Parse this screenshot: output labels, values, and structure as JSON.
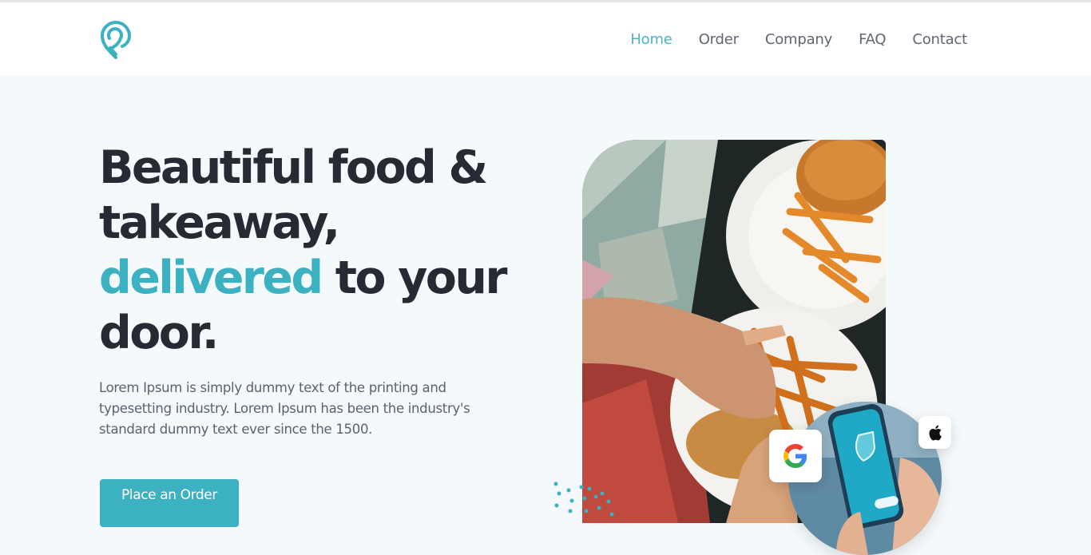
{
  "nav": {
    "items": [
      {
        "label": "Home",
        "active": true
      },
      {
        "label": "Order",
        "active": false
      },
      {
        "label": "Company",
        "active": false
      },
      {
        "label": "FAQ",
        "active": false
      },
      {
        "label": "Contact",
        "active": false
      }
    ]
  },
  "hero": {
    "title_line1": "Beautiful food &",
    "title_line2": "takeaway,",
    "title_accent": "delivered",
    "title_line3_rest": " to your",
    "title_line4": "door.",
    "description": "Lorem Ipsum is simply dummy text of the printing and typesetting industry. Lorem Ipsum has been the industry's standard dummy text ever since the 1500.",
    "cta_label": "Place an Order"
  },
  "icons": {
    "logo": "location-pin-logo-icon",
    "google": "google-icon",
    "apple": "apple-icon"
  },
  "colors": {
    "accent": "#3bb1c1",
    "heading": "#262b33",
    "body_text": "#5a6170",
    "nav_text": "#5f6774",
    "page_bg": "#f4f9fb"
  }
}
